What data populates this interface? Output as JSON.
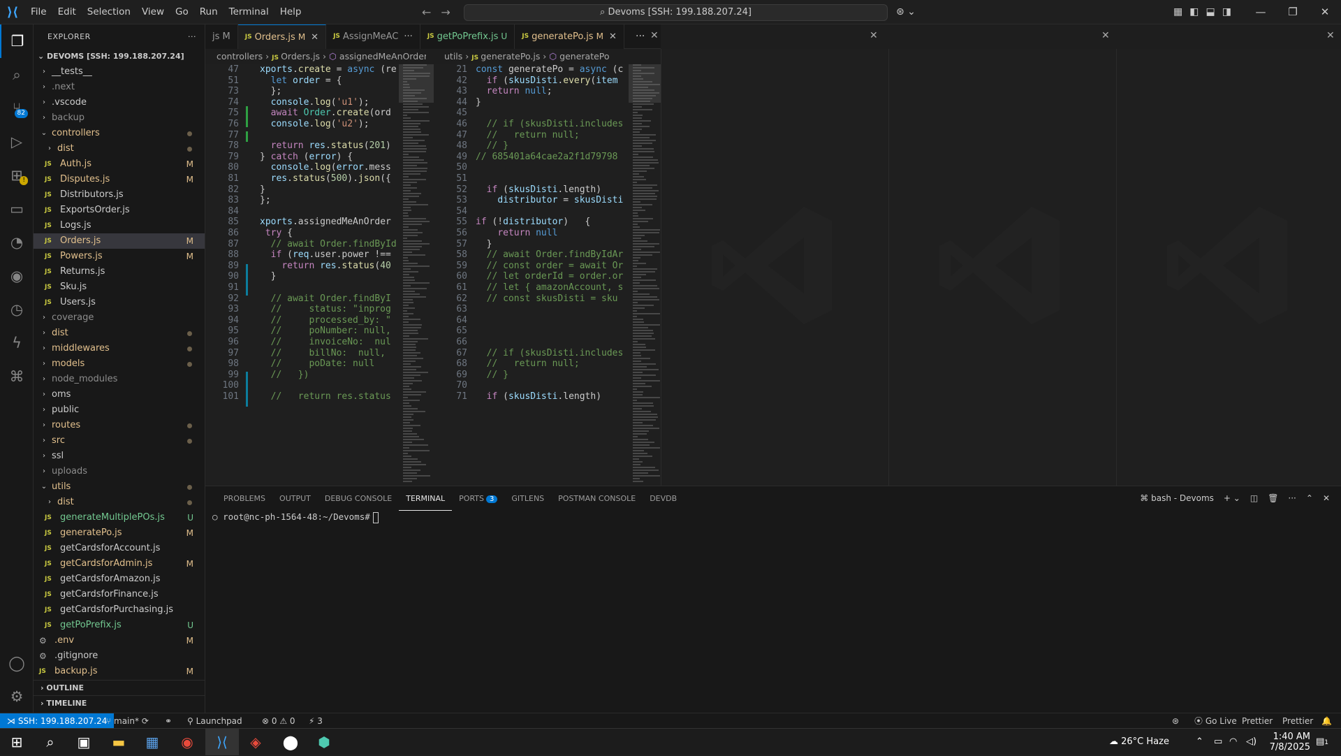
{
  "titlebar": {
    "menu": [
      "File",
      "Edit",
      "Selection",
      "View",
      "Go",
      "Run",
      "Terminal",
      "Help"
    ],
    "search": "Devoms [SSH: 199.188.207.24]"
  },
  "activity": {
    "scm_badge": "82"
  },
  "explorer": {
    "title": "EXPLORER",
    "root": "DEVOMS [SSH: 199.188.207.24]",
    "items": [
      {
        "label": "__tests__",
        "type": "folder",
        "depth": 0,
        "state": "norm"
      },
      {
        "label": ".next",
        "type": "folder",
        "depth": 0,
        "state": "dim"
      },
      {
        "label": ".vscode",
        "type": "folder",
        "depth": 0,
        "state": "norm"
      },
      {
        "label": "backup",
        "type": "folder",
        "depth": 0,
        "state": "dim"
      },
      {
        "label": "controllers",
        "type": "folder-open",
        "depth": 0,
        "state": "mod",
        "dot": true
      },
      {
        "label": "dist",
        "type": "folder",
        "depth": 1,
        "state": "mod",
        "dot": true
      },
      {
        "label": "Auth.js",
        "type": "js",
        "depth": 1,
        "state": "mod",
        "badge": "M"
      },
      {
        "label": "Disputes.js",
        "type": "js",
        "depth": 1,
        "state": "mod",
        "badge": "M"
      },
      {
        "label": "Distributors.js",
        "type": "js",
        "depth": 1,
        "state": "norm"
      },
      {
        "label": "ExportsOrder.js",
        "type": "js",
        "depth": 1,
        "state": "norm"
      },
      {
        "label": "Logs.js",
        "type": "js",
        "depth": 1,
        "state": "norm"
      },
      {
        "label": "Orders.js",
        "type": "js",
        "depth": 1,
        "state": "mod",
        "badge": "M",
        "selected": true
      },
      {
        "label": "Powers.js",
        "type": "js",
        "depth": 1,
        "state": "mod",
        "badge": "M"
      },
      {
        "label": "Returns.js",
        "type": "js",
        "depth": 1,
        "state": "norm"
      },
      {
        "label": "Sku.js",
        "type": "js",
        "depth": 1,
        "state": "norm"
      },
      {
        "label": "Users.js",
        "type": "js",
        "depth": 1,
        "state": "norm"
      },
      {
        "label": "coverage",
        "type": "folder",
        "depth": 0,
        "state": "dim"
      },
      {
        "label": "dist",
        "type": "folder",
        "depth": 0,
        "state": "mod",
        "dot": true
      },
      {
        "label": "middlewares",
        "type": "folder",
        "depth": 0,
        "state": "mod",
        "dot": true
      },
      {
        "label": "models",
        "type": "folder",
        "depth": 0,
        "state": "mod",
        "dot": true
      },
      {
        "label": "node_modules",
        "type": "folder",
        "depth": 0,
        "state": "dim"
      },
      {
        "label": "oms",
        "type": "folder",
        "depth": 0,
        "state": "norm"
      },
      {
        "label": "public",
        "type": "folder",
        "depth": 0,
        "state": "norm"
      },
      {
        "label": "routes",
        "type": "folder",
        "depth": 0,
        "state": "mod",
        "dot": true
      },
      {
        "label": "src",
        "type": "folder",
        "depth": 0,
        "state": "mod",
        "dot": true
      },
      {
        "label": "ssl",
        "type": "folder",
        "depth": 0,
        "state": "norm"
      },
      {
        "label": "uploads",
        "type": "folder",
        "depth": 0,
        "state": "dim"
      },
      {
        "label": "utils",
        "type": "folder-open",
        "depth": 0,
        "state": "mod",
        "dot": true
      },
      {
        "label": "dist",
        "type": "folder",
        "depth": 1,
        "state": "mod",
        "dot": true
      },
      {
        "label": "generateMultiplePOs.js",
        "type": "js",
        "depth": 1,
        "state": "new",
        "badge": "U"
      },
      {
        "label": "generatePo.js",
        "type": "js",
        "depth": 1,
        "state": "mod",
        "badge": "M"
      },
      {
        "label": "getCardsforAccount.js",
        "type": "js",
        "depth": 1,
        "state": "norm"
      },
      {
        "label": "getCardsforAdmin.js",
        "type": "js",
        "depth": 1,
        "state": "mod",
        "badge": "M"
      },
      {
        "label": "getCardsforAmazon.js",
        "type": "js",
        "depth": 1,
        "state": "norm"
      },
      {
        "label": "getCardsforFinance.js",
        "type": "js",
        "depth": 1,
        "state": "norm"
      },
      {
        "label": "getCardsforPurchasing.js",
        "type": "js",
        "depth": 1,
        "state": "norm"
      },
      {
        "label": "getPoPrefix.js",
        "type": "js",
        "depth": 1,
        "state": "new",
        "badge": "U"
      },
      {
        "label": ".env",
        "type": "gear",
        "depth": 0,
        "state": "mod",
        "badge": "M"
      },
      {
        "label": ".gitignore",
        "type": "gear",
        "depth": 0,
        "state": "norm"
      },
      {
        "label": "backup.js",
        "type": "js",
        "depth": 0,
        "state": "mod",
        "badge": "M"
      }
    ],
    "outline": "OUTLINE",
    "timeline": "TIMELINE"
  },
  "tabs": [
    {
      "label": "js M",
      "icon": "",
      "active": false
    },
    {
      "label": "Orders.js",
      "mark": "M",
      "icon": "JS",
      "active": true
    },
    {
      "label": "AssignMeAC",
      "mark": "",
      "icon": "JS",
      "active": false
    },
    {
      "label": "getPoPrefix.js",
      "mark": "U",
      "icon": "JS",
      "active": false
    },
    {
      "label": "generatePo.js",
      "mark": "M",
      "icon": "JS",
      "active": false
    }
  ],
  "crumbs_left": [
    "controllers",
    "Orders.js",
    "assignedMeAnOrder"
  ],
  "crumbs_right": [
    "utils",
    "generatePo.js",
    "generatePo"
  ],
  "code_left": [
    {
      "n": "47",
      "t": "xports.create = async (re"
    },
    {
      "n": "51",
      "t": "  let order = {"
    },
    {
      "n": "73",
      "t": "  };"
    },
    {
      "n": "74",
      "t": "  console.log('u1');"
    },
    {
      "n": "75",
      "t": "  await Order.create(ord"
    },
    {
      "n": "76",
      "t": "  console.log('u2');"
    },
    {
      "n": "77",
      "t": ""
    },
    {
      "n": "78",
      "t": "  return res.status(201)"
    },
    {
      "n": "79",
      "t": "} catch (error) {"
    },
    {
      "n": "80",
      "t": "  console.log(error.mess"
    },
    {
      "n": "81",
      "t": "  res.status(500).json({"
    },
    {
      "n": "82",
      "t": "}"
    },
    {
      "n": "83",
      "t": "};"
    },
    {
      "n": "84",
      "t": ""
    },
    {
      "n": "85",
      "t": "xports.assignedMeAnOrder"
    },
    {
      "n": "86",
      "t": " try {"
    },
    {
      "n": "87",
      "t": "  // await Order.findById"
    },
    {
      "n": "88",
      "t": "  if (req.user.power !=="
    },
    {
      "n": "89",
      "t": "    return res.status(40"
    },
    {
      "n": "90",
      "t": "  }"
    },
    {
      "n": "91",
      "t": ""
    },
    {
      "n": "92",
      "t": "  // await Order.findByI"
    },
    {
      "n": "93",
      "t": "  //     status: \"inprog"
    },
    {
      "n": "94",
      "t": "  //     processed_by: \""
    },
    {
      "n": "95",
      "t": "  //     poNumber: null,"
    },
    {
      "n": "96",
      "t": "  //     invoiceNo:  nul"
    },
    {
      "n": "97",
      "t": "  //     billNo:  null,"
    },
    {
      "n": "98",
      "t": "  //     poDate: null"
    },
    {
      "n": "99",
      "t": "  //   })"
    },
    {
      "n": "100",
      "t": ""
    },
    {
      "n": "101",
      "t": "  //   return res.status"
    }
  ],
  "code_right": [
    {
      "n": "21",
      "t": "const generatePo = async (c"
    },
    {
      "n": "42",
      "t": "  if (skusDisti.every(item"
    },
    {
      "n": "43",
      "t": "  return null;"
    },
    {
      "n": "44",
      "t": "}"
    },
    {
      "n": "45",
      "t": ""
    },
    {
      "n": "46",
      "t": "  // if (skusDisti.includes"
    },
    {
      "n": "47",
      "t": "  //   return null;"
    },
    {
      "n": "48",
      "t": "  // }"
    },
    {
      "n": "49",
      "t": "// 685401a64cae2a2f1d79798"
    },
    {
      "n": "50",
      "t": ""
    },
    {
      "n": "51",
      "t": ""
    },
    {
      "n": "52",
      "t": "  if (skusDisti.length)"
    },
    {
      "n": "53",
      "t": "    distributor = skusDisti"
    },
    {
      "n": "54",
      "t": ""
    },
    {
      "n": "55",
      "t": "if (!distributor)   {"
    },
    {
      "n": "56",
      "t": "    return null"
    },
    {
      "n": "57",
      "t": "  }"
    },
    {
      "n": "58",
      "t": "  // await Order.findByIdAr"
    },
    {
      "n": "59",
      "t": "  // const order = await Or"
    },
    {
      "n": "60",
      "t": "  // let orderId = order.or"
    },
    {
      "n": "61",
      "t": "  // let { amazonAccount, s"
    },
    {
      "n": "62",
      "t": "  // const skusDisti = sku"
    },
    {
      "n": "63",
      "t": ""
    },
    {
      "n": "64",
      "t": ""
    },
    {
      "n": "65",
      "t": ""
    },
    {
      "n": "66",
      "t": ""
    },
    {
      "n": "67",
      "t": "  // if (skusDisti.includes"
    },
    {
      "n": "68",
      "t": "  //   return null;"
    },
    {
      "n": "69",
      "t": "  // }"
    },
    {
      "n": "70",
      "t": ""
    },
    {
      "n": "71",
      "t": "  if (skusDisti.length)"
    }
  ],
  "panel": {
    "tabs": [
      "PROBLEMS",
      "OUTPUT",
      "DEBUG CONSOLE",
      "TERMINAL",
      "PORTS",
      "GITLENS",
      "POSTMAN CONSOLE",
      "DEVDB"
    ],
    "active": "TERMINAL",
    "ports_badge": "3",
    "terminal_name": "bash - Devoms",
    "prompt": "root@nc-ph-1564-48:~/Devoms#"
  },
  "status": {
    "remote": "SSH: 199.188.207.24",
    "branch": "main*",
    "launchpad": "Launchpad",
    "errors": "0",
    "warnings": "0",
    "ports": "3",
    "golive": "Go Live",
    "prettier1": "Prettier",
    "prettier2": "Prettier"
  },
  "taskbar": {
    "weather": "26°C  Haze",
    "time": "1:40 AM",
    "date": "7/8/2025",
    "notif": "1"
  }
}
